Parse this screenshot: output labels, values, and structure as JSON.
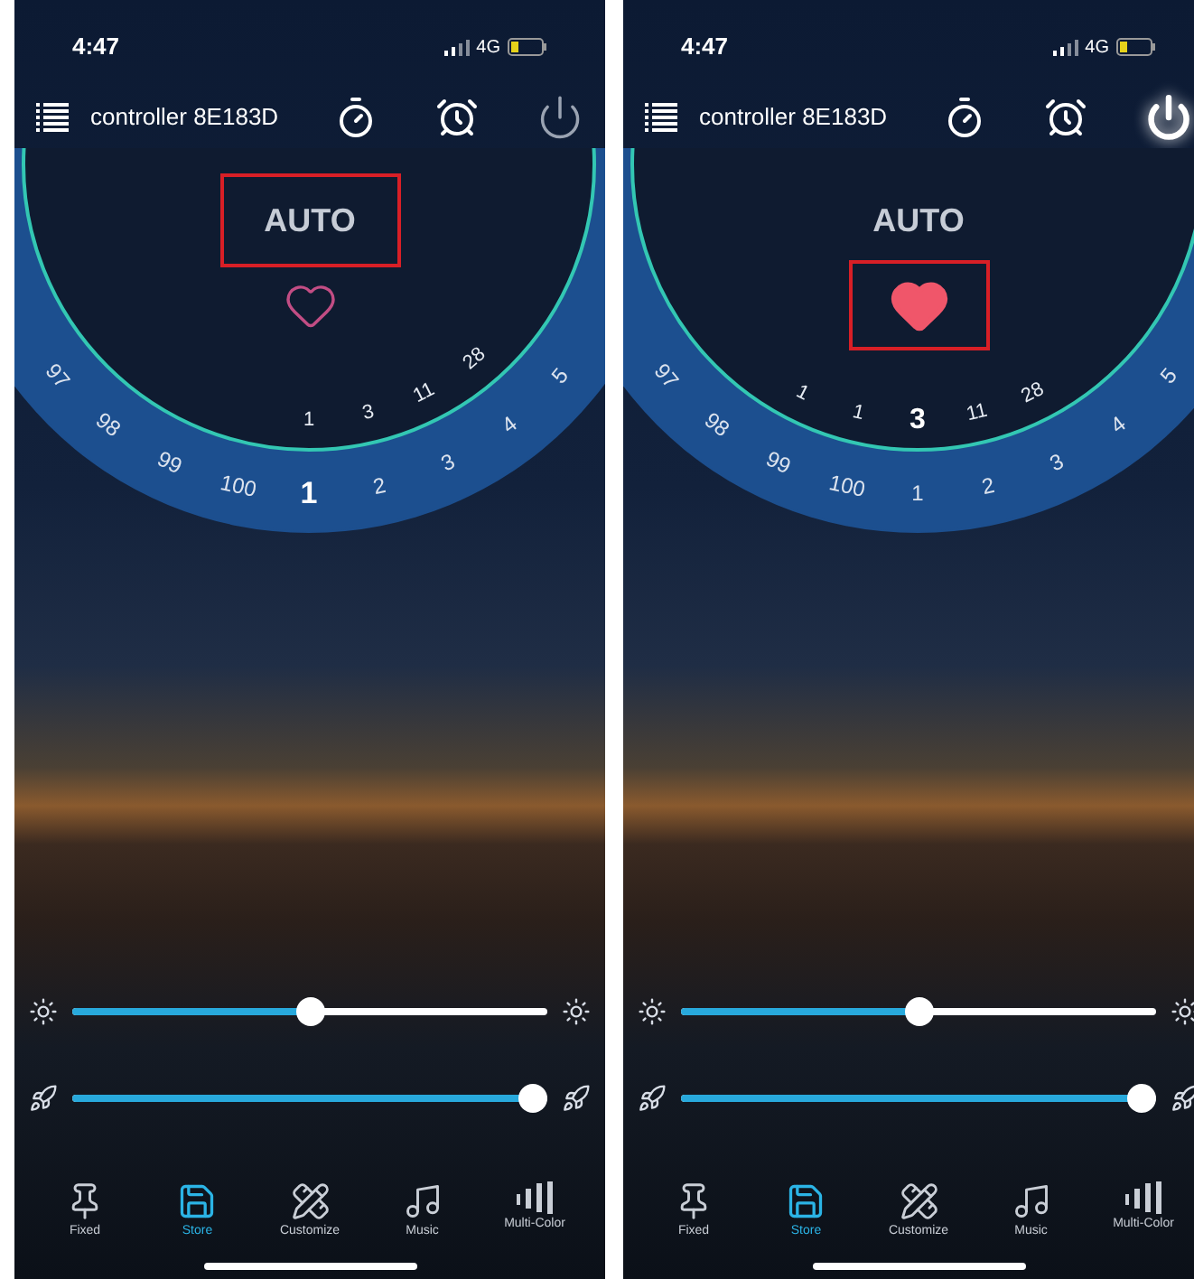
{
  "phones": [
    {
      "status_bar": {
        "time": "4:47",
        "network": "4G"
      },
      "header": {
        "title": "controller 8E183D",
        "power_on": false
      },
      "mode": {
        "label": "AUTO",
        "highlighted": true
      },
      "favorite": {
        "on": false,
        "highlighted": false
      },
      "dial": {
        "inner": [
          {
            "label": "1",
            "selected": false
          },
          {
            "label": "3",
            "selected": false
          },
          {
            "label": "11",
            "selected": false
          },
          {
            "label": "28",
            "selected": false
          }
        ],
        "outer": [
          {
            "label": "97",
            "selected": false
          },
          {
            "label": "98",
            "selected": false
          },
          {
            "label": "99",
            "selected": false
          },
          {
            "label": "100",
            "selected": false
          },
          {
            "label": "1",
            "selected": true
          },
          {
            "label": "2",
            "selected": false
          },
          {
            "label": "3",
            "selected": false
          },
          {
            "label": "4",
            "selected": false
          },
          {
            "label": "5",
            "selected": false
          }
        ]
      },
      "sliders": [
        {
          "kind": "brightness",
          "level": 0.5
        },
        {
          "kind": "speed",
          "level": 1
        }
      ],
      "tabs": [
        {
          "label": "Fixed",
          "selected": false
        },
        {
          "label": "Store",
          "selected": true
        },
        {
          "label": "Customize",
          "selected": false
        },
        {
          "label": "Music",
          "selected": false
        },
        {
          "label": "Multi-Color",
          "selected": false
        }
      ]
    },
    {
      "status_bar": {
        "time": "4:47",
        "network": "4G"
      },
      "header": {
        "title": "controller 8E183D",
        "power_on": true
      },
      "mode": {
        "label": "AUTO",
        "highlighted": false
      },
      "favorite": {
        "on": true,
        "highlighted": true
      },
      "dial": {
        "inner": [
          {
            "label": "1",
            "selected": false
          },
          {
            "label": "1",
            "selected": false
          },
          {
            "label": "3",
            "selected": true
          },
          {
            "label": "11",
            "selected": false
          },
          {
            "label": "28",
            "selected": false
          }
        ],
        "outer": [
          {
            "label": "97",
            "selected": false
          },
          {
            "label": "98",
            "selected": false
          },
          {
            "label": "99",
            "selected": false
          },
          {
            "label": "100",
            "selected": false
          },
          {
            "label": "1",
            "selected": false
          },
          {
            "label": "2",
            "selected": false
          },
          {
            "label": "3",
            "selected": false
          },
          {
            "label": "4",
            "selected": false
          },
          {
            "label": "5",
            "selected": false
          }
        ]
      },
      "sliders": [
        {
          "kind": "brightness",
          "level": 0.5
        },
        {
          "kind": "speed",
          "level": 1
        }
      ],
      "tabs": [
        {
          "label": "Fixed",
          "selected": false
        },
        {
          "label": "Store",
          "selected": true
        },
        {
          "label": "Customize",
          "selected": false
        },
        {
          "label": "Music",
          "selected": false
        },
        {
          "label": "Multi-Color",
          "selected": false
        }
      ]
    }
  ]
}
